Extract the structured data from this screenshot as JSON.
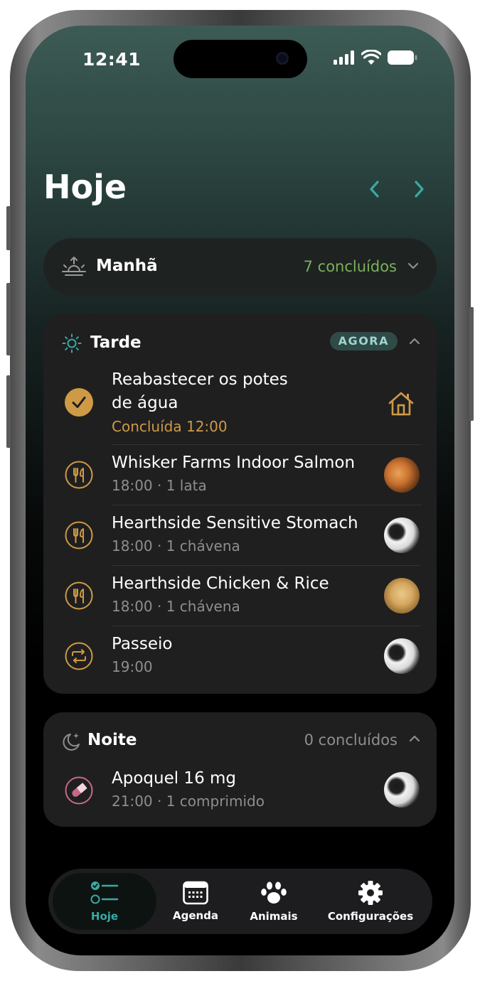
{
  "status_bar": {
    "time": "12:41"
  },
  "header": {
    "title": "Hoje"
  },
  "colors": {
    "accent": "#3aa9a2",
    "gold": "#cf9a45",
    "green": "#7bb05a",
    "pink": "#c46a86",
    "card": "#1f1f20"
  },
  "sections": {
    "morning": {
      "label": "Manhã",
      "status": "7 concluídos",
      "icon": "sunrise-icon"
    },
    "afternoon": {
      "label": "Tarde",
      "badge": "AGORA",
      "icon": "sun-icon",
      "items": [
        {
          "title_line1": "Reabastecer os potes",
          "title_line2": "de água",
          "subtitle": "Concluída 12:00",
          "icon": "check-circle-icon",
          "trailing": "house-icon"
        },
        {
          "title": "Whisker Farms Indoor Salmon",
          "subtitle": "18:00 · 1 lata",
          "icon": "fork-knife-icon",
          "avatar": "orange-cat"
        },
        {
          "title": "Hearthside Sensitive Stomach",
          "subtitle": "18:00 · 1 chávena",
          "icon": "fork-knife-icon",
          "avatar": "border-collie"
        },
        {
          "title": "Hearthside Chicken & Rice",
          "subtitle": "18:00 · 1 chávena",
          "icon": "fork-knife-icon",
          "avatar": "golden-retriever"
        },
        {
          "title": "Passeio",
          "subtitle": "19:00",
          "icon": "repeat-icon",
          "avatar": "border-collie"
        }
      ]
    },
    "night": {
      "label": "Noite",
      "status": "0 concluídos",
      "icon": "moon-stars-icon",
      "items": [
        {
          "title": "Apoquel 16 mg",
          "subtitle": "21:00 · 1 comprimido",
          "icon": "pill-icon",
          "avatar": "border-collie"
        }
      ]
    }
  },
  "tabbar": {
    "tabs": [
      {
        "label": "Hoje",
        "icon": "checklist-icon",
        "active": true
      },
      {
        "label": "Agenda",
        "icon": "calendar-icon"
      },
      {
        "label": "Animais",
        "icon": "paw-icon"
      },
      {
        "label": "Configurações",
        "icon": "gear-icon"
      }
    ]
  }
}
